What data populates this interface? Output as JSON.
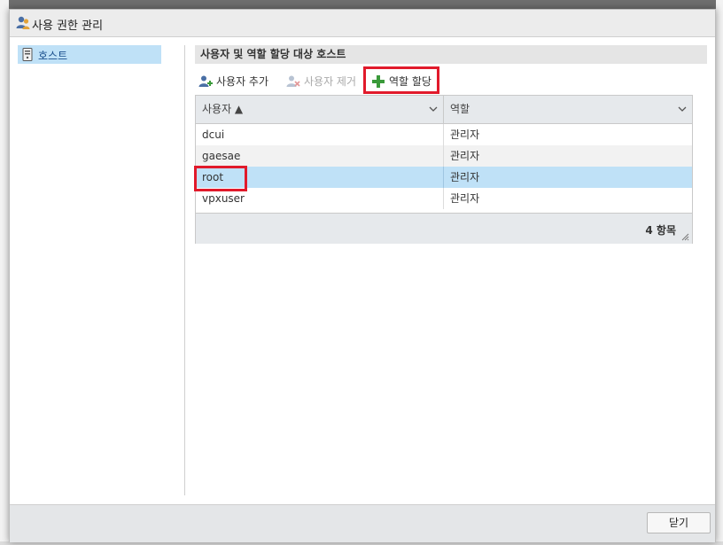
{
  "dialog": {
    "title": "사용 권한 관리",
    "title_icon": "users-icon"
  },
  "sidebar": {
    "items": [
      {
        "label": "호스트",
        "icon": "host-server-icon",
        "selected": true
      }
    ]
  },
  "main": {
    "section_title": "사용자 및 역할 할당 대상 호스트",
    "toolbar": {
      "add_user": "사용자 추가",
      "remove_user": "사용자 제거",
      "assign_role": "역할 할당"
    },
    "grid": {
      "columns": [
        {
          "label": "사용자 ▲",
          "sort": "ascending"
        },
        {
          "label": "역할"
        }
      ],
      "rows": [
        {
          "user": "dcui",
          "role": "관리자"
        },
        {
          "user": "gaesae",
          "role": "관리자"
        },
        {
          "user": "root",
          "role": "관리자",
          "selected": true
        },
        {
          "user": "vpxuser",
          "role": "관리자"
        }
      ],
      "count_label": "4 항목"
    }
  },
  "footer": {
    "close_label": "닫기"
  },
  "colors": {
    "selection": "#bfe1f7",
    "highlight_box": "#e11a2b",
    "link_text": "#1a4e8c"
  }
}
